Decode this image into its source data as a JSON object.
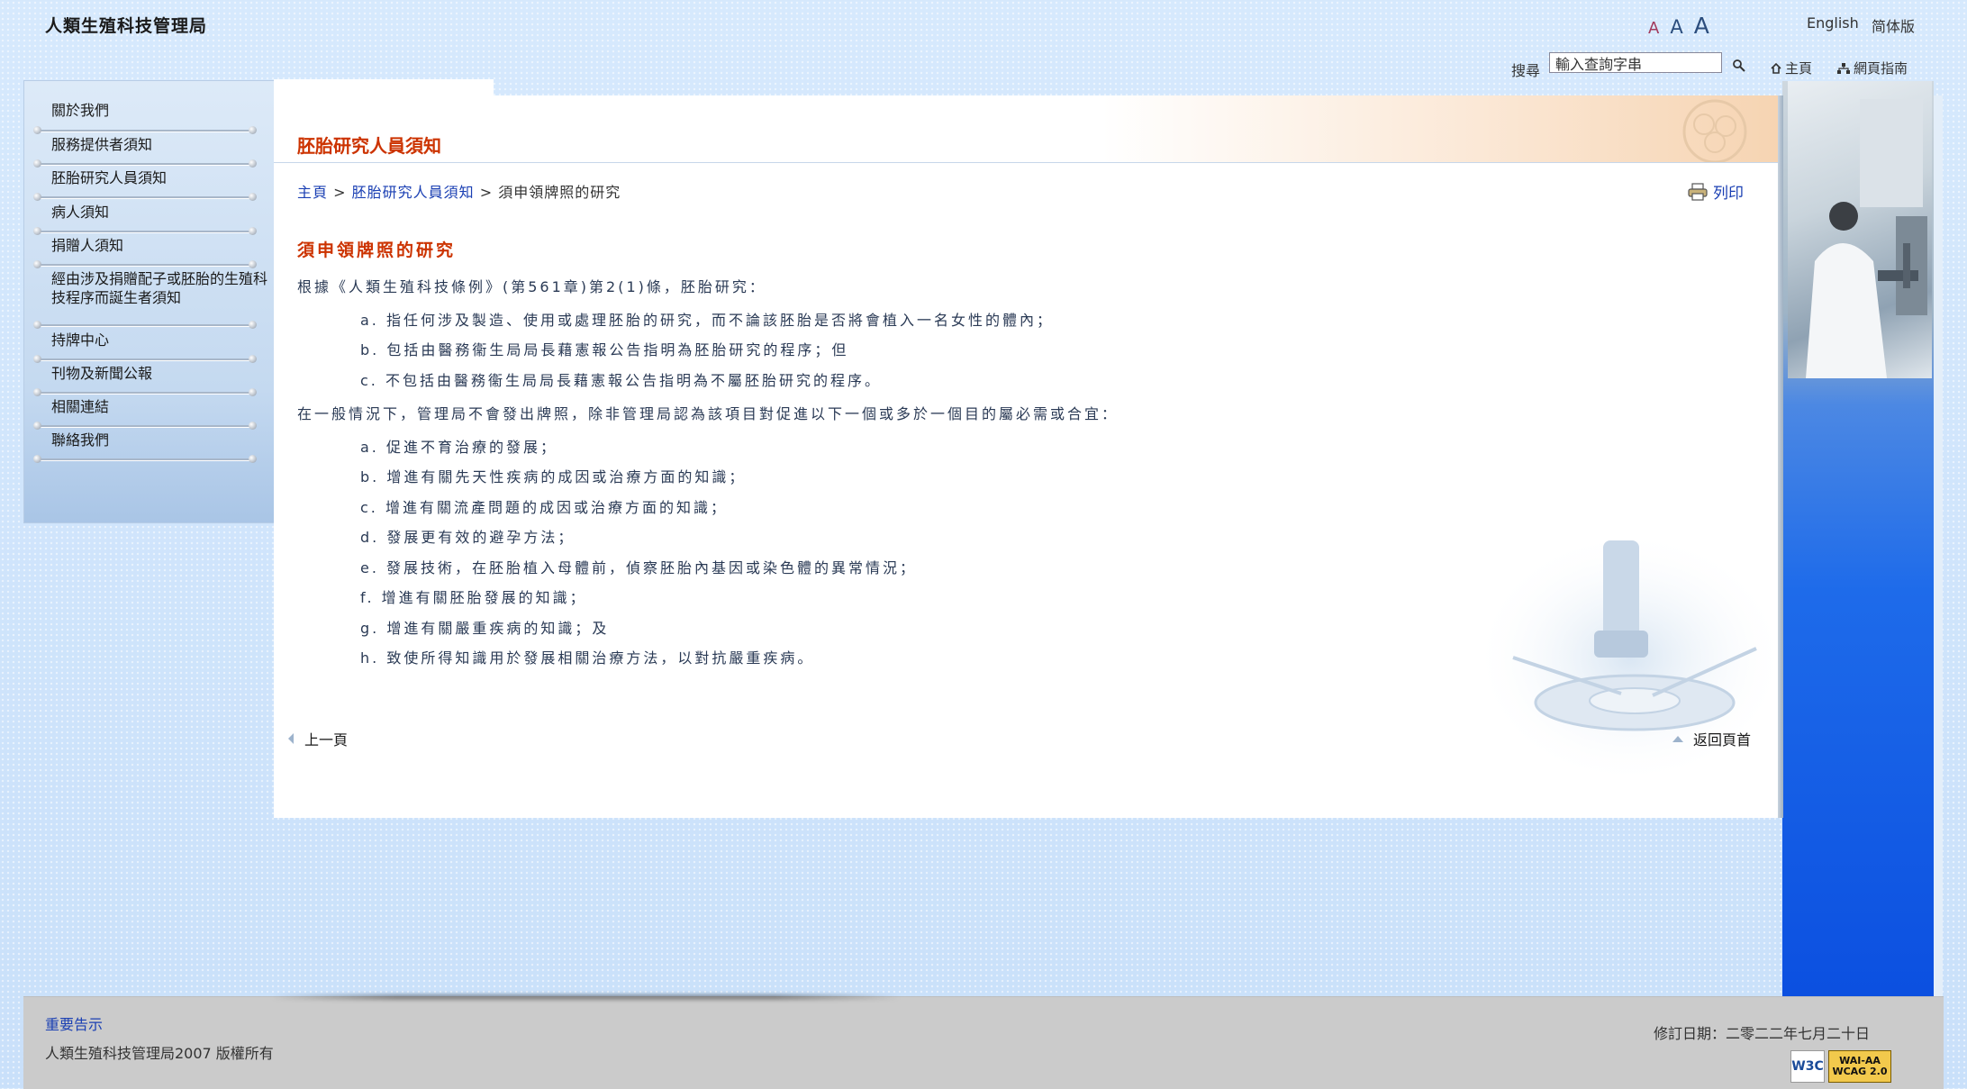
{
  "header": {
    "site_title": "人類生殖科技管理局",
    "font_sizes": [
      "A",
      "A",
      "A"
    ],
    "lang_english": "English",
    "lang_simplified": "简体版",
    "search_label": "搜尋",
    "search_value": "輸入查詢字串",
    "home_link": "主頁",
    "sitemap_link": "網頁指南"
  },
  "sidebar": {
    "items": [
      {
        "label": "關於我們"
      },
      {
        "label": "服務提供者須知"
      },
      {
        "label": "胚胎研究人員須知"
      },
      {
        "label": "病人須知"
      },
      {
        "label": "捐贈人須知"
      },
      {
        "label": "經由涉及捐贈配子或胚胎的生殖科技程序而誕生者須知"
      },
      {
        "label": "持牌中心"
      },
      {
        "label": "刊物及新聞公報"
      },
      {
        "label": "相關連結"
      },
      {
        "label": "聯絡我們"
      }
    ]
  },
  "main": {
    "page_title": "胚胎研究人員須知",
    "breadcrumb": {
      "home": "主頁",
      "sep1": ">",
      "section": "胚胎研究人員須知",
      "sep2": ">",
      "current": "須申領牌照的研究"
    },
    "print_label": "列印",
    "section_title": "須申領牌照的研究",
    "intro": "根據《人類生殖科技條例》(第561章)第2(1)條，胚胎研究：",
    "definition_items": [
      {
        "marker": "a.",
        "text": "指任何涉及製造、使用或處理胚胎的研究，而不論該胚胎是否將會植入一名女性的體內；"
      },
      {
        "marker": "b.",
        "text": "包括由醫務衞生局局長藉憲報公告指明為胚胎研究的程序；但"
      },
      {
        "marker": "c.",
        "text": "不包括由醫務衞生局局長藉憲報公告指明為不屬胚胎研究的程序。"
      }
    ],
    "condition_intro": "在一般情況下，管理局不會發出牌照，除非管理局認為該項目對促進以下一個或多於一個目的屬必需或合宜：",
    "purpose_items": [
      {
        "marker": "a.",
        "text": "促進不育治療的發展；"
      },
      {
        "marker": "b.",
        "text": "增進有關先天性疾病的成因或治療方面的知識；"
      },
      {
        "marker": "c.",
        "text": "增進有關流產問題的成因或治療方面的知識；"
      },
      {
        "marker": "d.",
        "text": "發展更有效的避孕方法；"
      },
      {
        "marker": "e.",
        "text": "發展技術，在胚胎植入母體前，偵察胚胎內基因或染色體的異常情況；"
      },
      {
        "marker": "f.",
        "text": "增進有關胚胎發展的知識；"
      },
      {
        "marker": "g.",
        "text": "增進有關嚴重疾病的知識；及"
      },
      {
        "marker": "h.",
        "text": "致使所得知識用於發展相關治療方法，以對抗嚴重疾病。"
      }
    ],
    "prev_page": "上一頁",
    "back_to_top": "返回頁首"
  },
  "footer": {
    "notice": "重要告示",
    "copyright": "人類生殖科技管理局2007 版權所有",
    "revised": "修訂日期：二零二二年七月二十日",
    "badge_w3c": "W3C",
    "badge_wai_line1": "WAI-AA",
    "badge_wai_line2": "WCAG 2.0"
  },
  "colors": {
    "title_red": "#cc3300",
    "link_blue": "#1a3fb3",
    "bg_blue": "#cfe4fb"
  }
}
